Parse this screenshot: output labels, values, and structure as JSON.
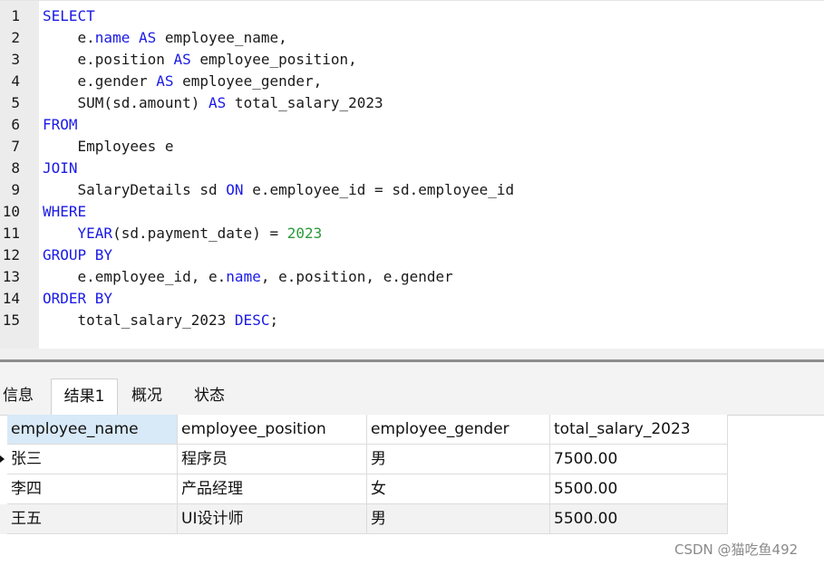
{
  "editor": {
    "lines": [
      {
        "n": "1",
        "segs": [
          {
            "t": "SELECT",
            "k": "kw"
          }
        ]
      },
      {
        "n": "2",
        "segs": [
          {
            "t": "    e."
          },
          {
            "t": "name",
            "k": "kw"
          },
          {
            "t": " "
          },
          {
            "t": "AS",
            "k": "kw"
          },
          {
            "t": " employee_name,"
          }
        ]
      },
      {
        "n": "3",
        "segs": [
          {
            "t": "    e.position "
          },
          {
            "t": "AS",
            "k": "kw"
          },
          {
            "t": " employee_position,"
          }
        ]
      },
      {
        "n": "4",
        "segs": [
          {
            "t": "    e.gender "
          },
          {
            "t": "AS",
            "k": "kw"
          },
          {
            "t": " employee_gender,"
          }
        ]
      },
      {
        "n": "5",
        "segs": [
          {
            "t": "    SUM(sd.amount) "
          },
          {
            "t": "AS",
            "k": "kw"
          },
          {
            "t": " total_salary_2023"
          }
        ]
      },
      {
        "n": "6",
        "segs": [
          {
            "t": "FROM",
            "k": "kw"
          }
        ]
      },
      {
        "n": "7",
        "segs": [
          {
            "t": "    Employees e"
          }
        ]
      },
      {
        "n": "8",
        "segs": [
          {
            "t": "JOIN",
            "k": "kw"
          }
        ]
      },
      {
        "n": "9",
        "segs": [
          {
            "t": "    SalaryDetails sd "
          },
          {
            "t": "ON",
            "k": "kw"
          },
          {
            "t": " e.employee_id = sd.employee_id"
          }
        ]
      },
      {
        "n": "10",
        "segs": [
          {
            "t": "WHERE",
            "k": "kw"
          }
        ]
      },
      {
        "n": "11",
        "segs": [
          {
            "t": "    "
          },
          {
            "t": "YEAR",
            "k": "kw"
          },
          {
            "t": "(sd.payment_date) = "
          },
          {
            "t": "2023",
            "k": "num"
          }
        ]
      },
      {
        "n": "12",
        "segs": [
          {
            "t": "GROUP BY",
            "k": "kw"
          }
        ]
      },
      {
        "n": "13",
        "segs": [
          {
            "t": "    e.employee_id, e."
          },
          {
            "t": "name",
            "k": "kw"
          },
          {
            "t": ", e.position, e.gender"
          }
        ]
      },
      {
        "n": "14",
        "segs": [
          {
            "t": "ORDER BY",
            "k": "kw"
          }
        ]
      },
      {
        "n": "15",
        "segs": [
          {
            "t": "    total_salary_2023 "
          },
          {
            "t": "DESC",
            "k": "kw"
          },
          {
            "t": ";"
          }
        ]
      }
    ]
  },
  "tabs": [
    {
      "label": "信息",
      "active": false
    },
    {
      "label": "结果1",
      "active": true
    },
    {
      "label": "概况",
      "active": false
    },
    {
      "label": "状态",
      "active": false
    }
  ],
  "result": {
    "columns": [
      "employee_name",
      "employee_position",
      "employee_gender",
      "total_salary_2023"
    ],
    "rows": [
      [
        "张三",
        "程序员",
        "男",
        "7500.00"
      ],
      [
        "李四",
        "产品经理",
        "女",
        "5500.00"
      ],
      [
        "王五",
        "UI设计师",
        "男",
        "5500.00"
      ]
    ],
    "current_row": 0
  },
  "colors": {
    "keyword": "#1a1ae6",
    "number": "#2a9a3a",
    "header_selected": "#d8e9f8"
  },
  "watermark": "CSDN @猫吃鱼492"
}
